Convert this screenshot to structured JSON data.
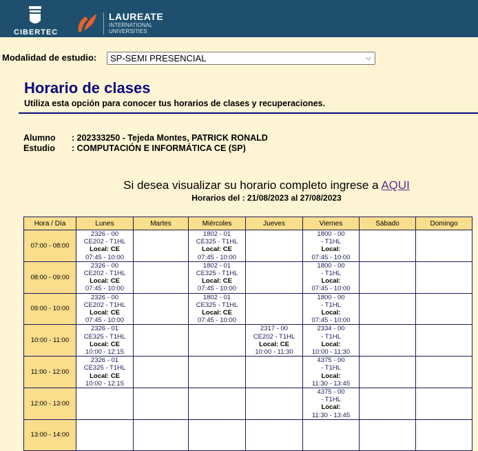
{
  "header": {
    "logo_left": "CIBERTEC",
    "logo_right_title": "LAUREATE",
    "logo_right_sub1": "INTERNATIONAL",
    "logo_right_sub2": "UNIVERSITIES",
    "colors": {
      "bar": "#1e4f6e",
      "accent": "#e8622a"
    }
  },
  "modalidad": {
    "label": "Modalidad de estudio:",
    "selected": "SP-SEMI PRESENCIAL"
  },
  "page": {
    "title": "Horario de clases",
    "subtitle": "Utiliza esta opción para conocer tus horarios de clases y recuperaciones."
  },
  "student": {
    "alumno_label": "Alumno",
    "alumno_value": ": 202333250 - Tejeda Montes, PATRICK RONALD",
    "estudio_label": "Estudio",
    "estudio_value": ": COMPUTACIÓN E INFORMÁTICA CE (SP)"
  },
  "link": {
    "text": "Si desea visualizar su horario completo ingrese a",
    "link_label": "AQUI"
  },
  "range": "Horarios del : 21/08/2023 al 27/08/2023",
  "schedule": {
    "headers": [
      "Hora / Día",
      "Lunes",
      "Martes",
      "Miércoles",
      "Jueves",
      "Viernes",
      "Sábado",
      "Domingo"
    ],
    "rows": [
      {
        "hour": "07:00 - 08:00",
        "cells": [
          {
            "l1": "2326 - 00",
            "l2": "CE202 - T1HL",
            "l3": "Local: CE",
            "l4": "07:45 - 10:00"
          },
          null,
          {
            "l1": "1802 - 01",
            "l2": "CE325 - T1HL",
            "l3": "Local: CE",
            "l4": "07:45 - 10:00"
          },
          null,
          {
            "l1": "1800 - 00",
            "l2": "- T1HL",
            "l3": "Local:",
            "l4": "07:45 - 10:00"
          },
          null,
          null
        ]
      },
      {
        "hour": "08:00 - 09:00",
        "cells": [
          {
            "l1": "2326 - 00",
            "l2": "CE202 - T1HL",
            "l3": "Local: CE",
            "l4": "07:45 - 10:00"
          },
          null,
          {
            "l1": "1802 - 01",
            "l2": "CE325 - T1HL",
            "l3": "Local: CE",
            "l4": "07:45 - 10:00"
          },
          null,
          {
            "l1": "1800 - 00",
            "l2": "- T1HL",
            "l3": "Local:",
            "l4": "07:45 - 10:00"
          },
          null,
          null
        ]
      },
      {
        "hour": "09:00 - 10:00",
        "cells": [
          {
            "l1": "2326 - 00",
            "l2": "CE202 - T1HL",
            "l3": "Local: CE",
            "l4": "07:45 - 10:00"
          },
          null,
          {
            "l1": "1802 - 01",
            "l2": "CE325 - T1HL",
            "l3": "Local: CE",
            "l4": "07:45 - 10:00"
          },
          null,
          {
            "l1": "1800 - 00",
            "l2": "- T1HL",
            "l3": "Local:",
            "l4": "07:45 - 10:00"
          },
          null,
          null
        ]
      },
      {
        "hour": "10:00 - 11:00",
        "cells": [
          {
            "l1": "2326 - 01",
            "l2": "CE325 - T1HL",
            "l3": "Local: CE",
            "l4": "10:00 - 12:15"
          },
          null,
          null,
          {
            "l1": "2317 - 00",
            "l2": "CE202 - T1HL",
            "l3": "Local: CE",
            "l4": "10:00 - 11:30"
          },
          {
            "l1": "2334 - 00",
            "l2": "- T1HL",
            "l3": "Local:",
            "l4": "10:00 - 11:30"
          },
          null,
          null
        ]
      },
      {
        "hour": "11:00 - 12:00",
        "cells": [
          {
            "l1": "2326 - 01",
            "l2": "CE325 - T1HL",
            "l3": "Local: CE",
            "l4": "10:00 - 12:15"
          },
          null,
          null,
          null,
          {
            "l1": "4375 - 00",
            "l2": "- T1HL",
            "l3": "Local:",
            "l4": "11:30 - 13:45"
          },
          null,
          null
        ]
      },
      {
        "hour": "12:00 - 13:00",
        "cells": [
          null,
          null,
          null,
          null,
          {
            "l1": "4375 - 00",
            "l2": "- T1HL",
            "l3": "Local:",
            "l4": "11:30 - 13:45"
          },
          null,
          null
        ]
      },
      {
        "hour": "13:00 - 14:00",
        "cells": [
          null,
          null,
          null,
          null,
          null,
          null,
          null
        ]
      }
    ]
  }
}
